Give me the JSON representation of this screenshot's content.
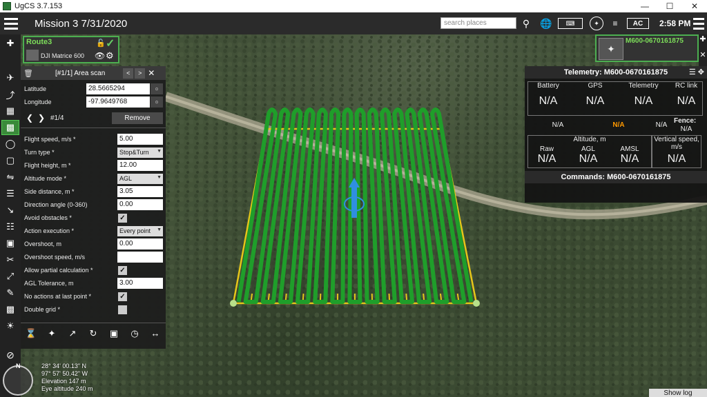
{
  "window": {
    "title": "UgCS 3.7.153",
    "controls": [
      "—",
      "☐",
      "✕"
    ]
  },
  "topbar": {
    "mission_title": "Mission 3 7/31/2020",
    "search_placeholder": "search places",
    "ac_label": "AC",
    "clock": "2:58 PM"
  },
  "route": {
    "name": "Route3",
    "drone": "DJI Matrice 600"
  },
  "scan_panel": {
    "title": "[#1/1] Area scan",
    "latitude_label": "Latitude",
    "latitude_value": "28.5665294",
    "longitude_label": "Longitude",
    "longitude_value": "-97.9649768",
    "waypoint_index": "#1/4",
    "remove_label": "Remove",
    "fields": [
      {
        "label": "Flight speed, m/s *",
        "kind": "input",
        "value": "5.00"
      },
      {
        "label": "Turn type *",
        "kind": "select",
        "value": "Stop&Turn"
      },
      {
        "label": "Flight height, m *",
        "kind": "input",
        "value": "12.00"
      },
      {
        "label": "Altitude mode *",
        "kind": "select",
        "value": "AGL"
      },
      {
        "label": "Side distance, m *",
        "kind": "input",
        "value": "3.05"
      },
      {
        "label": "Direction angle (0-360)",
        "kind": "input",
        "value": "0.00"
      },
      {
        "label": "Avoid obstacles *",
        "kind": "check",
        "value": "✓"
      },
      {
        "label": "Action execution *",
        "kind": "select",
        "value": "Every point"
      },
      {
        "label": "Overshoot, m",
        "kind": "input",
        "value": "0.00"
      },
      {
        "label": "Overshoot speed, m/s",
        "kind": "input",
        "value": ""
      },
      {
        "label": "Allow partial calculation *",
        "kind": "check",
        "value": "✓"
      },
      {
        "label": "AGL Tolerance, m",
        "kind": "input",
        "value": "3.00"
      },
      {
        "label": "No actions at last point *",
        "kind": "check",
        "value": "✓"
      },
      {
        "label": "Double grid *",
        "kind": "check",
        "value": ""
      }
    ]
  },
  "drone_card": {
    "name": "M600-0670161875"
  },
  "telemetry": {
    "title": "Telemetry: M600-0670161875",
    "headers": [
      "Battery",
      "GPS",
      "Telemetry",
      "RC link"
    ],
    "values": [
      "N/A",
      "N/A",
      "N/A",
      "N/A"
    ],
    "mid_values": [
      "N/A",
      "N/A",
      "N/A"
    ],
    "fence_label": "Fence:",
    "fence_value": "N/A",
    "altitude_label": "Altitude, m",
    "alt_headers": [
      "Raw",
      "AGL",
      "AMSL"
    ],
    "alt_values": [
      "N/A",
      "N/A",
      "N/A"
    ],
    "vspeed_label": "Vertical speed, m/s",
    "vspeed_value": "N/A",
    "commands_title": "Commands: M600-0670161875",
    "accent_color": "#ff9900"
  },
  "map_info": {
    "lat": "28° 34' 00.13\" N",
    "lon": "97° 57' 50.42\" W",
    "elevation": "Elevation 147 m",
    "eye_altitude": "Eye altitude 240 m",
    "compass_n": "N"
  },
  "show_log": "Show log"
}
